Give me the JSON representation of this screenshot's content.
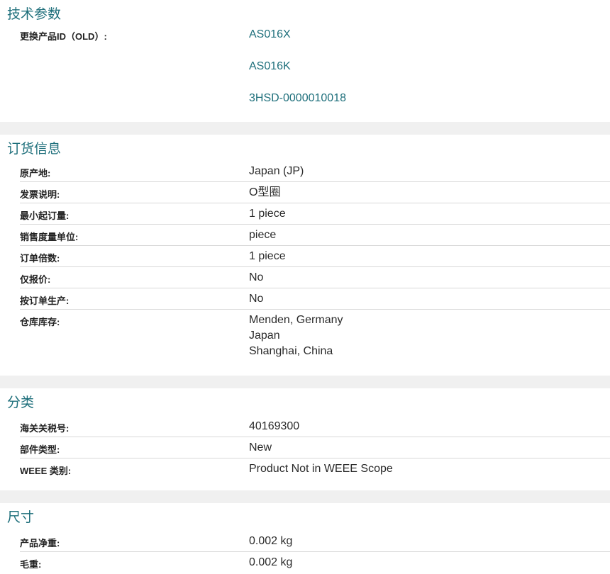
{
  "technical": {
    "title": "技术参数",
    "replaced_label": "更换产品ID（OLD）:",
    "replaced_ids": [
      "AS016X",
      "AS016K",
      "3HSD-0000010018"
    ]
  },
  "ordering": {
    "title": "订货信息",
    "rows": [
      {
        "label": "原产地:",
        "value": "Japan (JP)"
      },
      {
        "label": "发票说明:",
        "value": "O型圈"
      },
      {
        "label": "最小起订量:",
        "value": "1 piece"
      },
      {
        "label": "销售度量单位:",
        "value": "piece"
      },
      {
        "label": "订单倍数:",
        "value": "1 piece"
      },
      {
        "label": "仅报价:",
        "value": "No"
      },
      {
        "label": "按订单生产:",
        "value": "No"
      }
    ],
    "stock_label": "仓库库存:",
    "stock_values": [
      "Menden, Germany",
      "Japan",
      "Shanghai, China"
    ]
  },
  "classification": {
    "title": "分类",
    "rows": [
      {
        "label": "海关关税号:",
        "value": "40169300"
      },
      {
        "label": "部件类型:",
        "value": "New"
      },
      {
        "label": "WEEE 类别:",
        "value": "Product Not in WEEE Scope"
      }
    ]
  },
  "dimensions": {
    "title": "尺寸",
    "rows": [
      {
        "label": "产品净重:",
        "value": "0.002 kg"
      },
      {
        "label": "毛重:",
        "value": "0.002 kg"
      }
    ]
  }
}
